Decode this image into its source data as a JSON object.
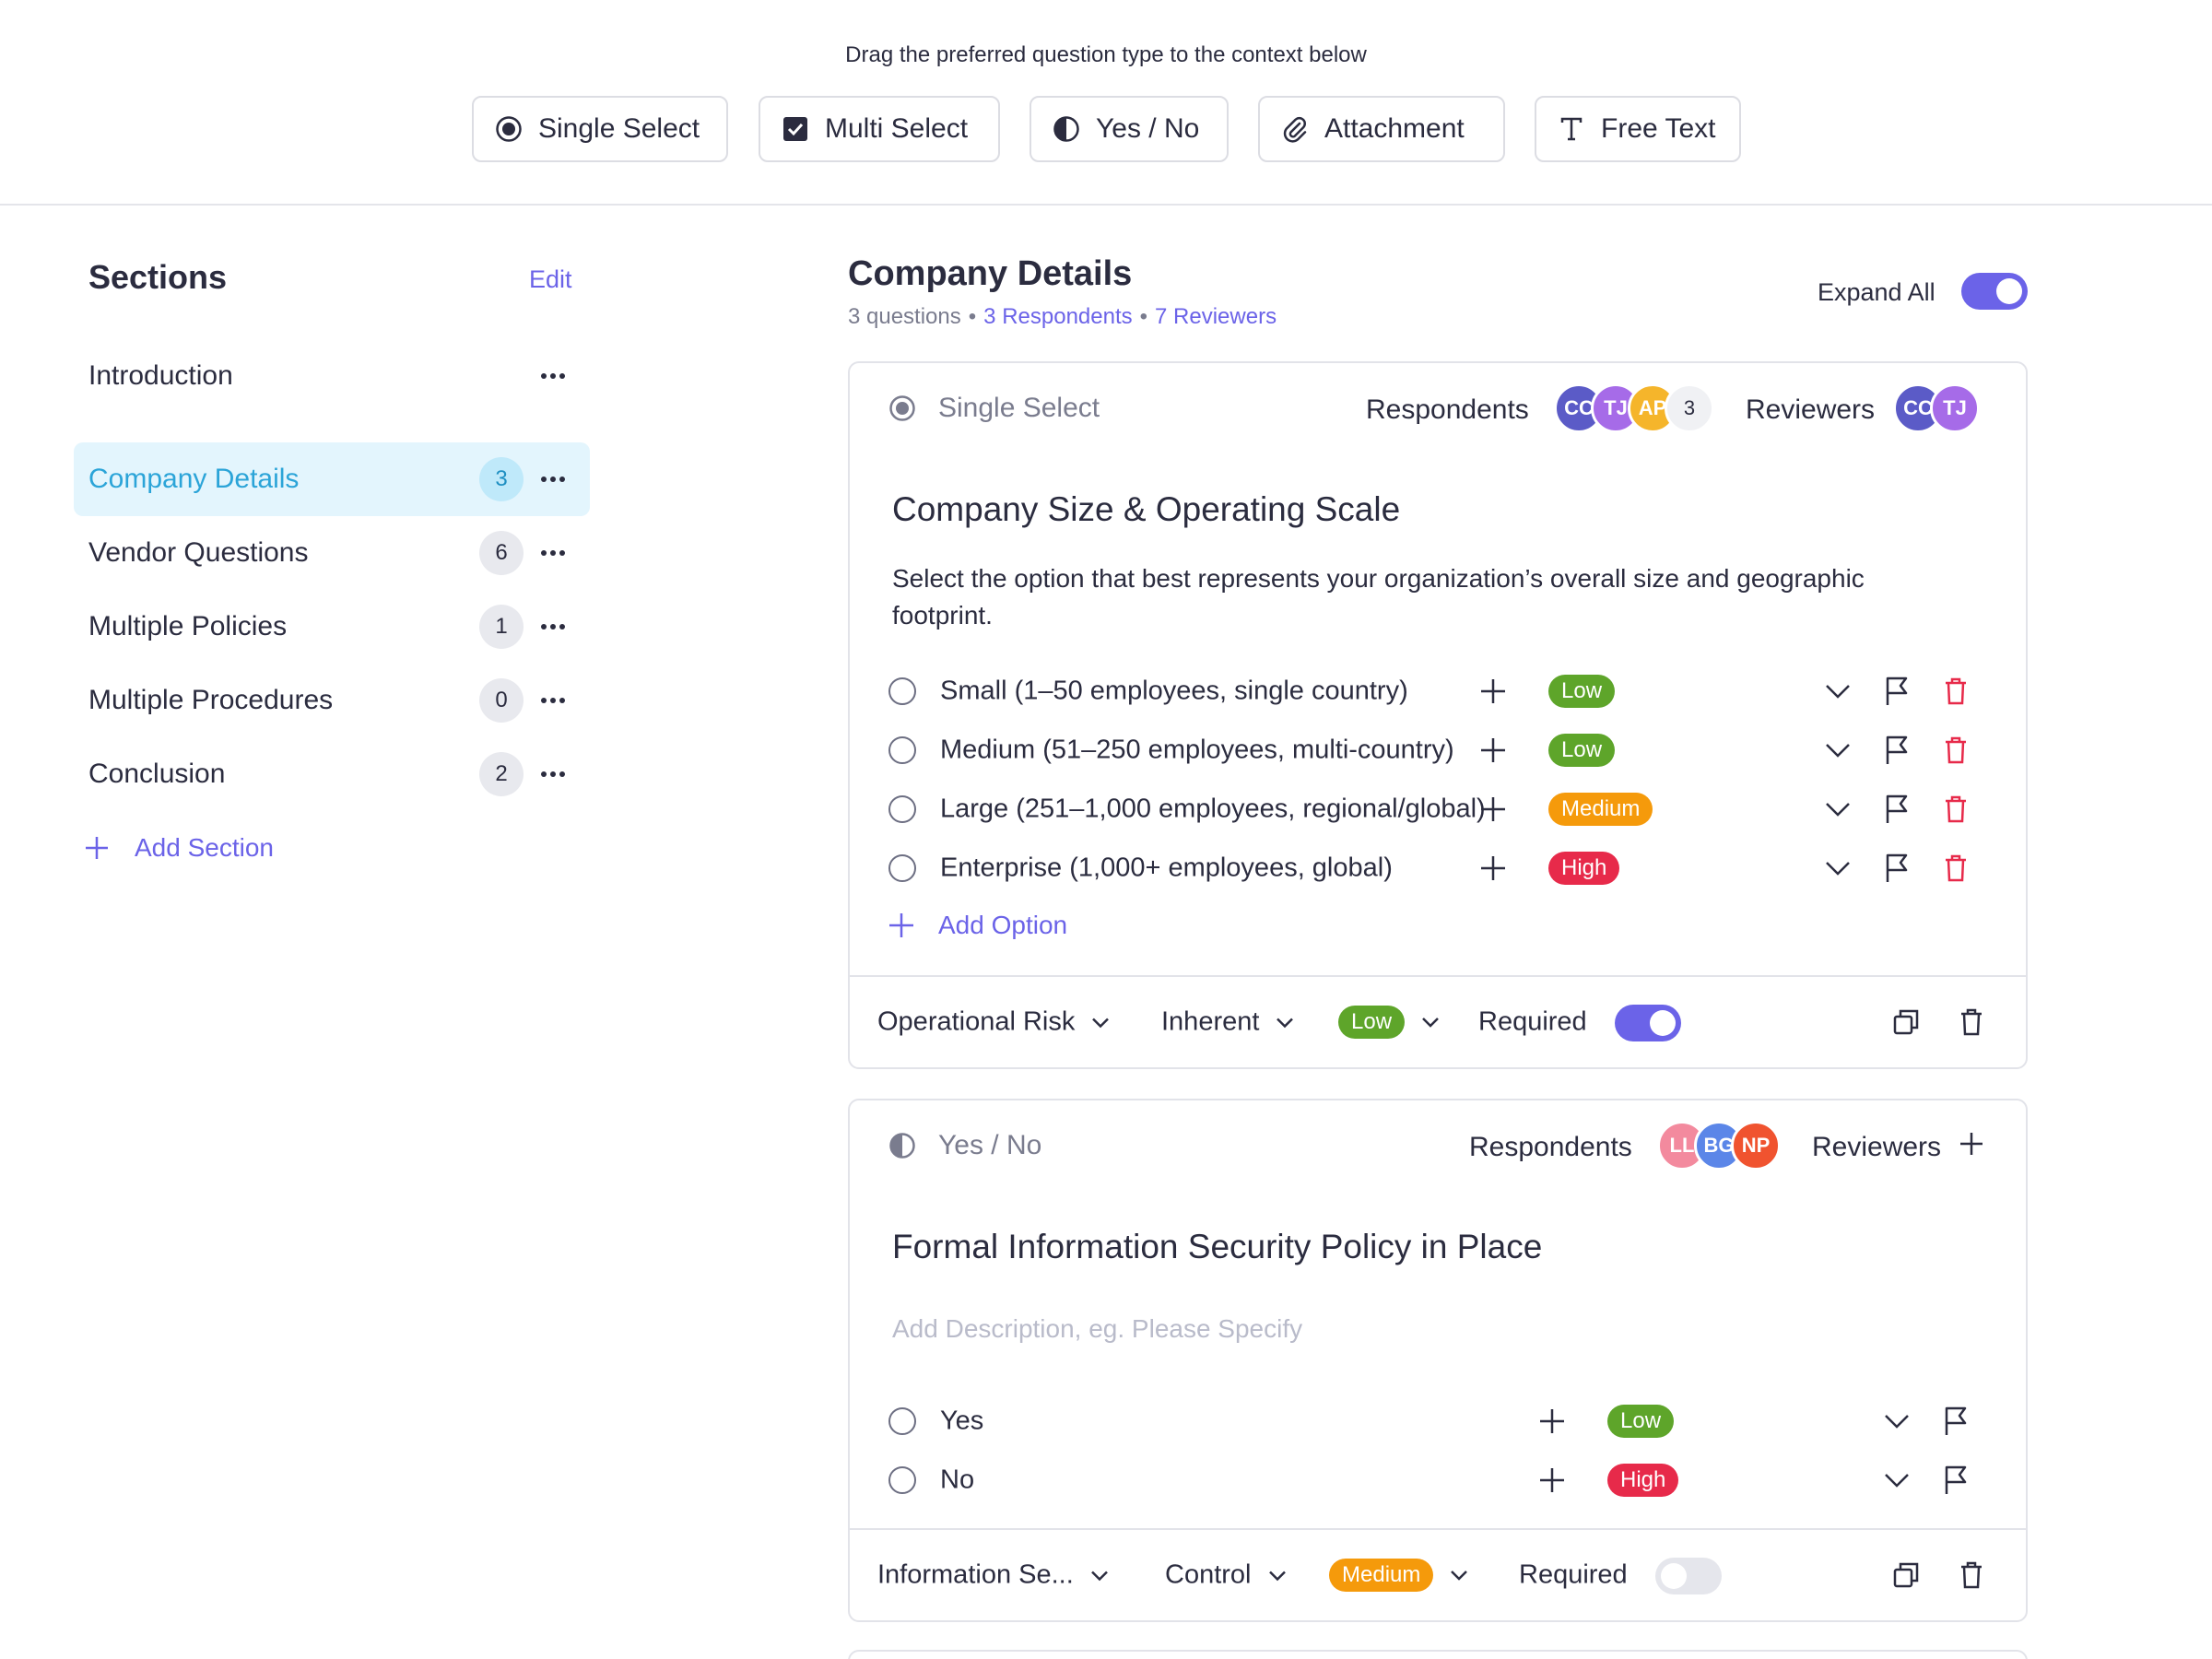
{
  "palette": {
    "hint": "Drag the preferred question type to the context below",
    "types": [
      {
        "label": "Single Select",
        "icon": "radio-icon"
      },
      {
        "label": "Multi Select",
        "icon": "checkbox-icon"
      },
      {
        "label": "Yes / No",
        "icon": "half-circle-icon"
      },
      {
        "label": "Attachment",
        "icon": "paperclip-icon"
      },
      {
        "label": "Free Text",
        "icon": "text-icon"
      }
    ]
  },
  "sidebar": {
    "title": "Sections",
    "edit_label": "Edit",
    "items": [
      {
        "label": "Introduction",
        "count": ""
      },
      {
        "label": "Company Details",
        "count": "3"
      },
      {
        "label": "Vendor Questions",
        "count": "6"
      },
      {
        "label": "Multiple Policies",
        "count": "1"
      },
      {
        "label": "Multiple Procedures",
        "count": "0"
      },
      {
        "label": "Conclusion",
        "count": "2"
      }
    ],
    "active_item": "Company Details",
    "add_label": "Add Section"
  },
  "main": {
    "title": "Company Details",
    "meta_questions": "3 questions",
    "meta_sep": "•",
    "meta_respondents": "3 Respondents",
    "meta_reviewers": "7 Reviewers",
    "expand_all_label": "Expand All",
    "expand_all_on": true
  },
  "colors": {
    "accent": "#6b63e8",
    "active_bg": "#e3f5fd",
    "low": "#5ea52a",
    "medium": "#f59a0b",
    "high": "#e72a4a"
  },
  "questions": [
    {
      "type_label": "Single Select",
      "respondents_label": "Respondents",
      "respondents": [
        {
          "initials": "CC",
          "color": "#5b5bc7"
        },
        {
          "initials": "TJ",
          "color": "#a66be8"
        },
        {
          "initials": "AP",
          "color": "#f5b52b"
        }
      ],
      "respondents_more": "3",
      "reviewers_label": "Reviewers",
      "reviewers": [
        {
          "initials": "CC",
          "color": "#5b5bc7"
        },
        {
          "initials": "TJ",
          "color": "#a66be8"
        }
      ],
      "title": "Company Size & Operating Scale",
      "description": "Select the option that best represents your organization’s overall size and geographic footprint.",
      "options": [
        {
          "label": "Small (1–50 employees, single country)",
          "risk": "Low"
        },
        {
          "label": "Medium (51–250 employees, multi-country)",
          "risk": "Low"
        },
        {
          "label": "Large (251–1,000 employees, regional/global)",
          "risk": "Medium"
        },
        {
          "label": "Enterprise (1,000+ employees, global)",
          "risk": "High"
        }
      ],
      "add_option_label": "Add Option",
      "footer": {
        "category": "Operational Risk",
        "risk_type": "Inherent",
        "risk_level": "Low",
        "required_label": "Required",
        "required_on": true
      }
    },
    {
      "type_label": "Yes / No",
      "respondents_label": "Respondents",
      "respondents": [
        {
          "initials": "LL",
          "color": "#f38a9e"
        },
        {
          "initials": "BG",
          "color": "#5b86e8"
        },
        {
          "initials": "NP",
          "color": "#f0532f"
        }
      ],
      "reviewers_label": "Reviewers",
      "title": "Formal Information Security Policy in Place",
      "description_placeholder": "Add Description, eg. Please Specify",
      "options": [
        {
          "label": "Yes",
          "risk": "Low"
        },
        {
          "label": "No",
          "risk": "High"
        }
      ],
      "footer": {
        "category": "Information Se...",
        "risk_type": "Control",
        "risk_level": "Medium",
        "required_label": "Required",
        "required_on": false
      }
    }
  ]
}
